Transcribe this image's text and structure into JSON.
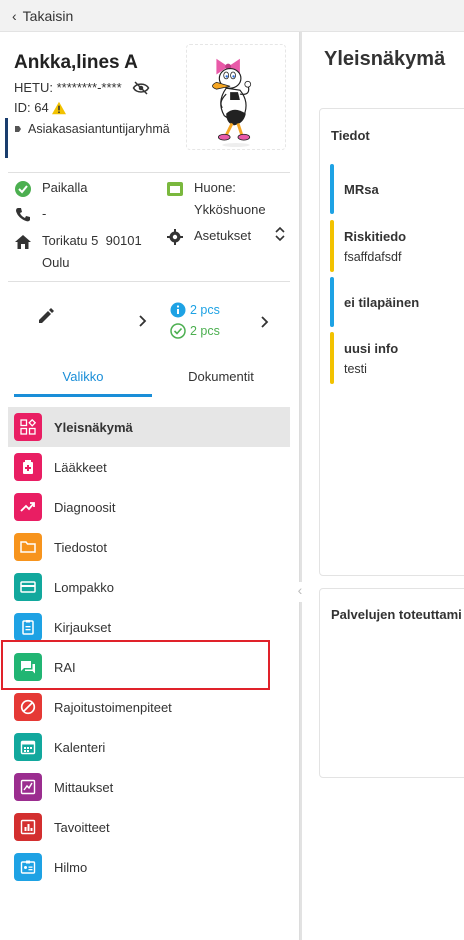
{
  "topbar": {
    "back_label": "Takaisin"
  },
  "patient": {
    "name": "Ankka,lines A",
    "hetu_label": "HETU: ********-****",
    "id_label": "ID: 64",
    "group": "Asiakasasiantuntijaryhmä"
  },
  "details": {
    "presence": "Paikalla",
    "phone": "-",
    "address_line1": "Torikatu 5  90101",
    "address_line2": "Oulu",
    "room_label": "Huone:",
    "room_value": "Ykköshuone",
    "settings": "Asetukset"
  },
  "actions": {
    "info_count": "2 pcs",
    "check_count": "2 pcs"
  },
  "tabs": {
    "menu": "Valikko",
    "documents": "Dokumentit"
  },
  "menu": [
    {
      "label": "Yleisnäkymä",
      "color": "#e91e63",
      "icon": "dashboard-icon"
    },
    {
      "label": "Lääkkeet",
      "color": "#e91e63",
      "icon": "medicine-icon"
    },
    {
      "label": "Diagnoosit",
      "color": "#e91e63",
      "icon": "trending-icon"
    },
    {
      "label": "Tiedostot",
      "color": "#f7941d",
      "icon": "folder-icon"
    },
    {
      "label": "Lompakko",
      "color": "#12a89d",
      "icon": "card-icon"
    },
    {
      "label": "Kirjaukset",
      "color": "#1ea2e4",
      "icon": "clipboard-icon"
    },
    {
      "label": "RAI",
      "color": "#21b573",
      "icon": "chat-icon"
    },
    {
      "label": "Rajoitustoimenpiteet",
      "color": "#e53935",
      "icon": "block-icon"
    },
    {
      "label": "Kalenteri",
      "color": "#12a89d",
      "icon": "calendar-icon"
    },
    {
      "label": "Mittaukset",
      "color": "#9b2d8f",
      "icon": "measure-icon"
    },
    {
      "label": "Tavoitteet",
      "color": "#d32f2f",
      "icon": "chart-icon"
    },
    {
      "label": "Hilmo",
      "color": "#1ea2e4",
      "icon": "badge-icon"
    }
  ],
  "right": {
    "title": "Yleisnäkymä",
    "card1_title": "Tiedot",
    "notes": [
      {
        "title": "MRsa",
        "text": "",
        "color": "#1ea2e4"
      },
      {
        "title": "Riskitiedo",
        "text": "fsaffdafsdf",
        "color": "#f2c200"
      },
      {
        "title": "ei tilapäinen",
        "text": "",
        "color": "#1ea2e4"
      },
      {
        "title": "uusi info",
        "text": "testi",
        "color": "#f2c200"
      }
    ],
    "card2_title": "Palvelujen toteuttami"
  },
  "colors": {
    "accent": "#1a8ed8",
    "highlight": "#e0222a",
    "presence_green": "#4caf50"
  }
}
